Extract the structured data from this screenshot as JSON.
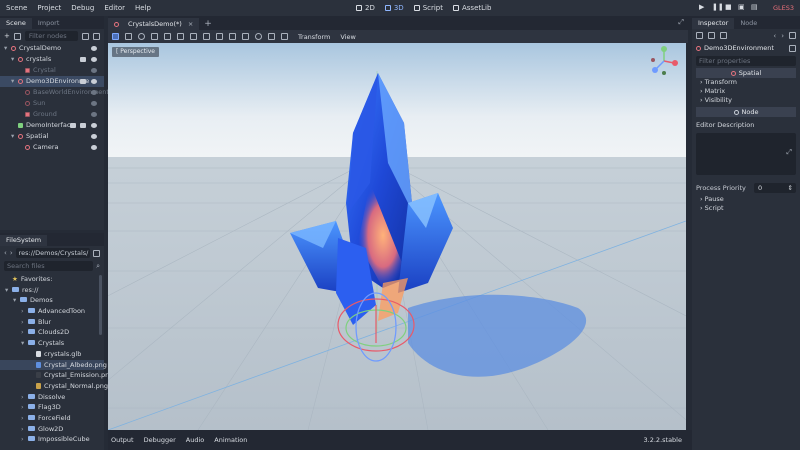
{
  "menu": [
    "Scene",
    "Project",
    "Debug",
    "Editor",
    "Help"
  ],
  "modes": [
    {
      "label": "2D",
      "icon": "2d-icon",
      "active": false
    },
    {
      "label": "3D",
      "icon": "3d-icon",
      "active": true
    },
    {
      "label": "Script",
      "icon": "script-icon",
      "active": false
    },
    {
      "label": "AssetLib",
      "icon": "assetlib-icon",
      "active": false
    }
  ],
  "renderer": "GLES3",
  "scene_dock": {
    "tabs": [
      "Scene",
      "Import"
    ],
    "filter_placeholder": "Filter nodes",
    "nodes": [
      {
        "label": "CrystalDemo",
        "indent": 0,
        "arrow": "▾",
        "dim": false,
        "selected": false
      },
      {
        "label": "crystals",
        "indent": 1,
        "arrow": "▾",
        "dim": false,
        "selected": false
      },
      {
        "label": "Crystal",
        "indent": 2,
        "arrow": "",
        "dim": true,
        "selected": false
      },
      {
        "label": "Demo3DEnvironme",
        "indent": 1,
        "arrow": "▾",
        "dim": false,
        "selected": true
      },
      {
        "label": "BaseWorldEnvironment",
        "indent": 2,
        "arrow": "",
        "dim": true,
        "selected": false
      },
      {
        "label": "Sun",
        "indent": 2,
        "arrow": "",
        "dim": true,
        "selected": false
      },
      {
        "label": "Ground",
        "indent": 2,
        "arrow": "",
        "dim": true,
        "selected": false
      },
      {
        "label": "DemoInterface",
        "indent": 1,
        "arrow": "",
        "dim": false,
        "selected": false
      },
      {
        "label": "Spatial",
        "indent": 1,
        "arrow": "▾",
        "dim": false,
        "selected": false
      },
      {
        "label": "Camera",
        "indent": 2,
        "arrow": "",
        "dim": false,
        "selected": false
      }
    ]
  },
  "filesystem": {
    "tab": "FileSystem",
    "path": "res://Demos/Crystals/",
    "search_placeholder": "Search files",
    "items": [
      {
        "label": "Favorites:",
        "indent": 0,
        "kind": "star"
      },
      {
        "label": "res://",
        "indent": 0,
        "kind": "folder",
        "arrow": "▾"
      },
      {
        "label": "Demos",
        "indent": 1,
        "kind": "folder",
        "arrow": "▾"
      },
      {
        "label": "AdvancedToon",
        "indent": 2,
        "kind": "folder",
        "arrow": "›"
      },
      {
        "label": "Blur",
        "indent": 2,
        "kind": "folder",
        "arrow": "›"
      },
      {
        "label": "Clouds2D",
        "indent": 2,
        "kind": "folder",
        "arrow": "›"
      },
      {
        "label": "Crystals",
        "indent": 2,
        "kind": "folder",
        "arrow": "▾"
      },
      {
        "label": "crystals.glb",
        "indent": 3,
        "kind": "glb"
      },
      {
        "label": "Crystal_Albedo.png",
        "indent": 3,
        "kind": "png-blue",
        "selected": true
      },
      {
        "label": "Crystal_Emission.pn",
        "indent": 3,
        "kind": "png-dark"
      },
      {
        "label": "Crystal_Normal.png",
        "indent": 3,
        "kind": "png-multi"
      },
      {
        "label": "Dissolve",
        "indent": 2,
        "kind": "folder",
        "arrow": "›"
      },
      {
        "label": "Flag3D",
        "indent": 2,
        "kind": "folder",
        "arrow": "›"
      },
      {
        "label": "ForceField",
        "indent": 2,
        "kind": "folder",
        "arrow": "›"
      },
      {
        "label": "Glow2D",
        "indent": 2,
        "kind": "folder",
        "arrow": "›"
      },
      {
        "label": "ImpossibleCube",
        "indent": 2,
        "kind": "folder",
        "arrow": "›"
      }
    ]
  },
  "editor_tab": "CrystalsDemo(*)",
  "viewport_toolbar": {
    "transform": "Transform",
    "view": "View"
  },
  "viewport_label": "[ Perspective",
  "bottom_tabs": [
    "Output",
    "Debugger",
    "Audio",
    "Animation"
  ],
  "version": "3.2.2.stable",
  "inspector": {
    "tabs": [
      "Inspector",
      "Node"
    ],
    "object": "Demo3DEnvironment",
    "filter_placeholder": "Filter properties",
    "section_spatial": "Spatial",
    "spatial_props": [
      "Transform",
      "Matrix",
      "Visibility"
    ],
    "section_node": "Node",
    "editor_description": "Editor Description",
    "process_priority_label": "Process Priority",
    "process_priority_value": "0",
    "node_props": [
      "Pause",
      "Script"
    ]
  }
}
